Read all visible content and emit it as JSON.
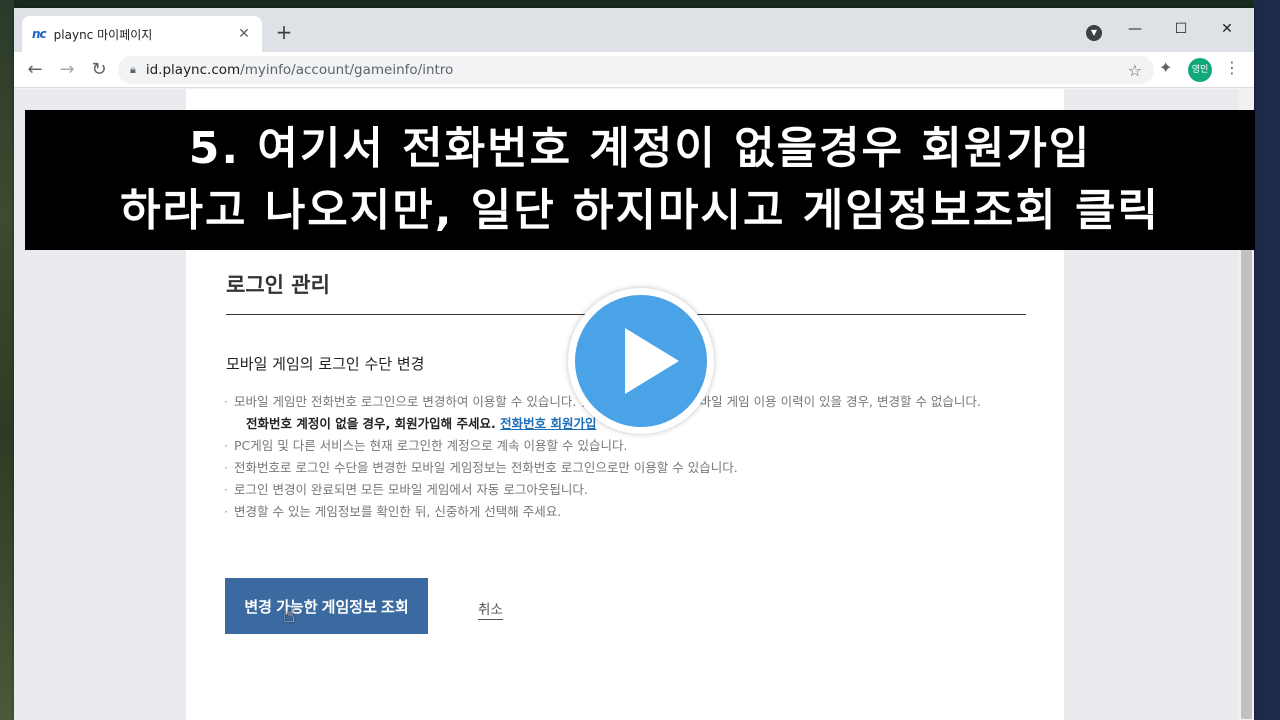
{
  "browser": {
    "tab_title": "plaync 마이페이지",
    "tab_favicon": "nc",
    "url_host": "id.plaync.com",
    "url_path": "/myinfo/account/gameinfo/intro",
    "avatar_label": "영민"
  },
  "caption": {
    "line1": "5. 여기서 전화번호 계정이 없을경우 회원가입",
    "line2": "하라고 나오지만, 일단 하지마시고 게임정보조회 클릭"
  },
  "page": {
    "section_title": "로그인 관리",
    "subsection_title": "모바일 게임의 로그인 수단 변경",
    "note1": "모바일 게임만 전화번호 로그인으로 변경하여 이용할 수 있습니다. 단, 전화번호 계정에 모바일 게임 이용 이력이 있을 경우, 변경할 수 없습니다.",
    "note1_bold": "전화번호 계정이 없을 경우, 회원가입해 주세요.",
    "signup_link": "전화번호 회원가입",
    "note2": "PC게임 및 다른 서비스는 현재 로그인한 계정으로 계속 이용할 수 있습니다.",
    "note3": "전화번호로 로그인 수단을 변경한 모바일 게임정보는 전화번호 로그인으로만 이용할 수 있습니다.",
    "note4": "로그인 변경이 완료되면 모든 모바일 게임에서 자동 로그아웃됩니다.",
    "note5": "변경할 수 있는 게임정보를 확인한 뒤, 신중하게 선택해 주세요.",
    "primary_button": "변경 가능한 게임정보 조회",
    "cancel_link": "취소"
  },
  "colors": {
    "primary_button": "#3b6aa0",
    "link": "#1c6fb5",
    "play_button": "#4aa3e6",
    "avatar": "#13a87c"
  }
}
